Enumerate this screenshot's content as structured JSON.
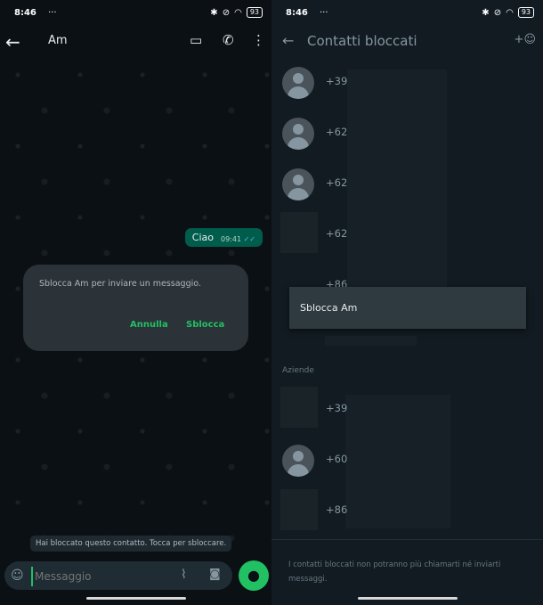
{
  "status": {
    "time": "8:46",
    "dots": "···",
    "battery": "93"
  },
  "chat": {
    "contact_name": "Am",
    "message_text": "Ciao",
    "message_time": "09:41",
    "dialog": {
      "text": "Sblocca Am              per inviare un messaggio.",
      "cancel": "Annulla",
      "confirm": "Sblocca"
    },
    "blocked_notice": "Hai bloccato questo contatto. Tocca per sbloccare.",
    "composer_placeholder": "Messaggio"
  },
  "blocked": {
    "title": "Contatti bloccati",
    "rows": [
      {
        "number": "+39"
      },
      {
        "number": "+62"
      },
      {
        "number": "+62"
      },
      {
        "number": "+62"
      },
      {
        "number": "+86"
      }
    ],
    "section_label": "Aziende",
    "business_rows": [
      {
        "number": "+39"
      },
      {
        "number": "+60"
      },
      {
        "number": "+86"
      }
    ],
    "context_menu_item": "Sblocca Am",
    "footer": "I contatti bloccati non potranno più chiamarti né inviarti messaggi."
  },
  "colors": {
    "accent": "#21c063",
    "bubble": "#005c4b",
    "bg": "#0b1014"
  }
}
